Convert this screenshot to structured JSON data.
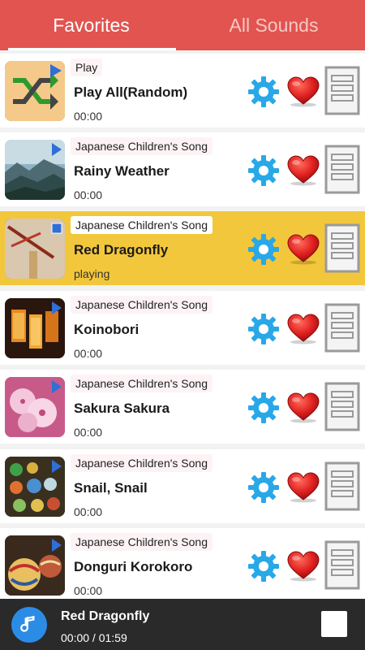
{
  "tabs": [
    {
      "label": "Favorites"
    },
    {
      "label": "All Sounds"
    }
  ],
  "rows": [
    {
      "tag": "Play",
      "title": "Play All(Random)",
      "time": "00:00",
      "thumb": "shuffle-icon"
    },
    {
      "tag": "Japanese Children's Song",
      "title": "Rainy Weather",
      "time": "00:00",
      "thumb": "misty-mountains-thumbnail"
    },
    {
      "tag": "Japanese Children's Song",
      "title": "Red Dragonfly",
      "time": "playing",
      "thumb": "dragonfly-thumbnail"
    },
    {
      "tag": "Japanese Children's Song",
      "title": "Koinobori",
      "time": "00:00",
      "thumb": "lanterns-thumbnail"
    },
    {
      "tag": "Japanese Children's Song",
      "title": "Sakura Sakura",
      "time": "00:00",
      "thumb": "cherry-blossom-thumbnail"
    },
    {
      "tag": "Japanese Children's Song",
      "title": "Snail, Snail",
      "time": "00:00",
      "thumb": "marbles-thumbnail"
    },
    {
      "tag": "Japanese Children's Song",
      "title": "Donguri Korokoro",
      "time": "00:00",
      "thumb": "temari-balls-thumbnail"
    }
  ],
  "player": {
    "title": "Red Dragonfly",
    "time": "00:00 / 01:59"
  },
  "colors": {
    "header": "#e2544f",
    "active_row": "#f3c73b",
    "gear": "#29a8e8",
    "heart": "#e02020",
    "player_bar": "#2a2a2a",
    "note_button": "#2b8ce6"
  }
}
